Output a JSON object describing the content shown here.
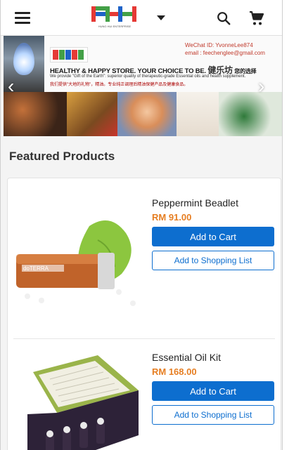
{
  "header": {
    "menu_icon": "menu-icon",
    "logo_name": "HUNG HUI ENTERPRISE",
    "dropdown_icon": "caret-down-icon",
    "search_icon": "search-icon",
    "cart_icon": "shopping-cart-icon",
    "logo_colors": [
      "#e53935",
      "#43a047",
      "#1e63c8"
    ]
  },
  "banner": {
    "logo_name": "HEALTHY & HAPPY STORE",
    "wechat": "WeChat ID: YvonneLee874",
    "email": "email : feechenglee@gmail.com",
    "headline_en": "HEALTHY & HAPPY STORE. YOUR CHOICE TO BE.",
    "headline_cn": "健乐坊",
    "headline_cn_small": "您的选择",
    "line1": "We provide \"Gift of the Earth\": superior quality of therapeutic-grade Essential oils and health supplement.",
    "line2": "我们提供\"大地的礼物\"，精油。专业纯正调理后精油保健产品及健康食品。",
    "prev_icon": "chevron-left-icon",
    "next_icon": "chevron-right-icon"
  },
  "featured": {
    "title": "Featured Products"
  },
  "products": [
    {
      "name": "Peppermint Beadlet",
      "price": "RM 91.00",
      "add_to_cart": "Add to Cart",
      "add_to_list": "Add to Shopping List",
      "image_label": "doTERRA"
    },
    {
      "name": "Essential Oil Kit",
      "price": "RM 168.00",
      "add_to_cart": "Add to Cart",
      "add_to_list": "Add to Shopping List"
    }
  ],
  "colors": {
    "accent_blue": "#0d6ecf",
    "price_orange": "#e67e22"
  }
}
